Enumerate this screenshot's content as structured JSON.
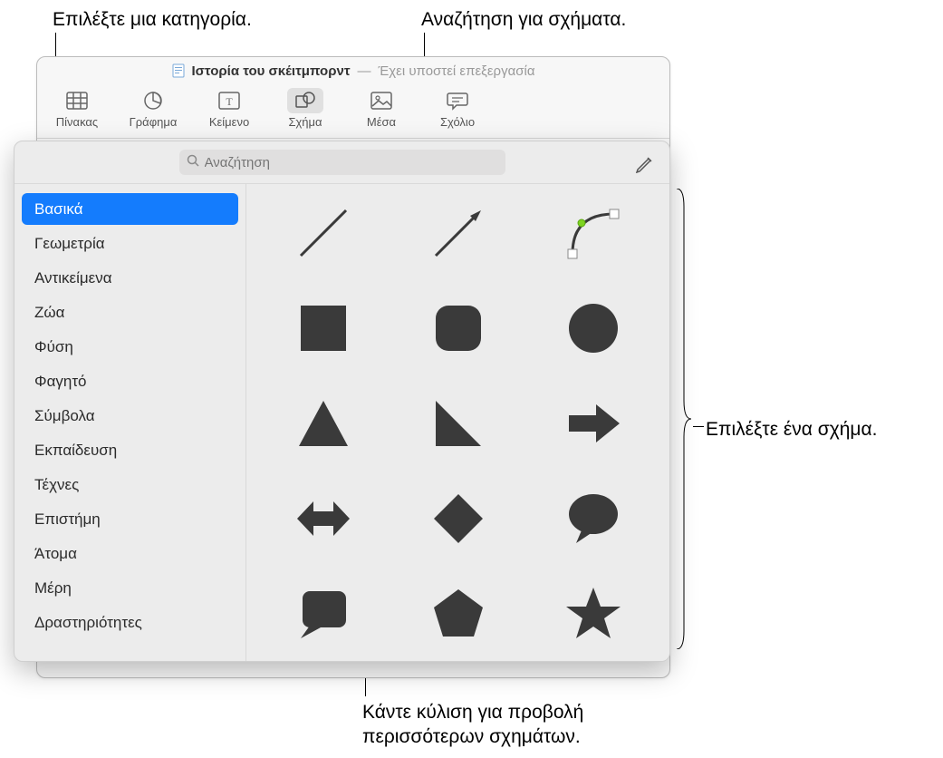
{
  "callouts": {
    "category": "Επιλέξτε μια κατηγορία.",
    "search": "Αναζήτηση για σχήματα.",
    "select_shape": "Επιλέξτε ένα σχήμα.",
    "scroll_line1": "Κάντε κύλιση για προβολή",
    "scroll_line2": "περισσότερων σχημάτων."
  },
  "titlebar": {
    "doc_title": "Ιστορία του σκέιτμπορντ",
    "dash": "—",
    "edited": "Έχει υποστεί επεξεργασία"
  },
  "toolbar": {
    "table": "Πίνακας",
    "chart": "Γράφημα",
    "text": "Κείμενο",
    "shape": "Σχήμα",
    "media": "Μέσα",
    "comment": "Σχόλιο"
  },
  "search": {
    "placeholder": "Αναζήτηση"
  },
  "categories": [
    "Βασικά",
    "Γεωμετρία",
    "Αντικείμενα",
    "Ζώα",
    "Φύση",
    "Φαγητό",
    "Σύμβολα",
    "Εκπαίδευση",
    "Τέχνες",
    "Επιστήμη",
    "Άτομα",
    "Μέρη",
    "Δραστηριότητες"
  ],
  "selected_category_index": 0,
  "shapes": [
    {
      "id": "line",
      "name": "line"
    },
    {
      "id": "arrow-line",
      "name": "arrow-line"
    },
    {
      "id": "curve",
      "name": "curve"
    },
    {
      "id": "square",
      "name": "square"
    },
    {
      "id": "rounded-square",
      "name": "rounded-square"
    },
    {
      "id": "circle",
      "name": "circle"
    },
    {
      "id": "triangle",
      "name": "triangle"
    },
    {
      "id": "right-triangle",
      "name": "right-triangle"
    },
    {
      "id": "arrow-right",
      "name": "arrow-right"
    },
    {
      "id": "double-arrow",
      "name": "double-arrow"
    },
    {
      "id": "diamond",
      "name": "diamond"
    },
    {
      "id": "speech-bubble",
      "name": "speech-bubble"
    },
    {
      "id": "square-callout",
      "name": "square-callout"
    },
    {
      "id": "pentagon",
      "name": "pentagon"
    },
    {
      "id": "star",
      "name": "star"
    }
  ],
  "colors": {
    "shape_fill": "#3a3a3a",
    "selection": "#147cfd"
  }
}
